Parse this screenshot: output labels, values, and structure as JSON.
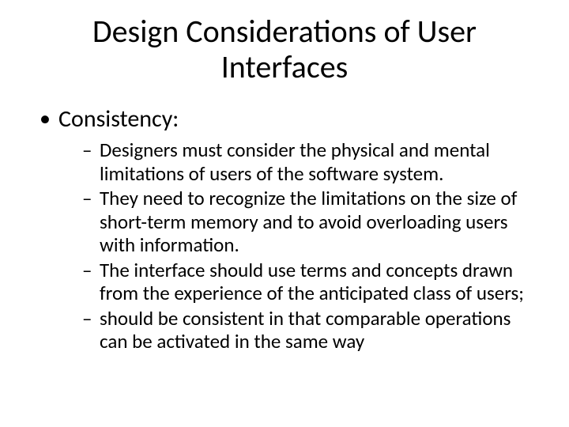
{
  "title": "Design Considerations of User Interfaces",
  "bullets": {
    "main": {
      "label": "Consistency:",
      "subs": [
        "Designers must consider the physical and mental limitations of users of the software system.",
        "They need to recognize the limitations on the size of short-term memory and to avoid overloading users with information.",
        "The interface should use terms and concepts drawn from the experience of the anticipated class of users;",
        "should be consistent in that comparable operations can be activated in the same way"
      ]
    }
  }
}
